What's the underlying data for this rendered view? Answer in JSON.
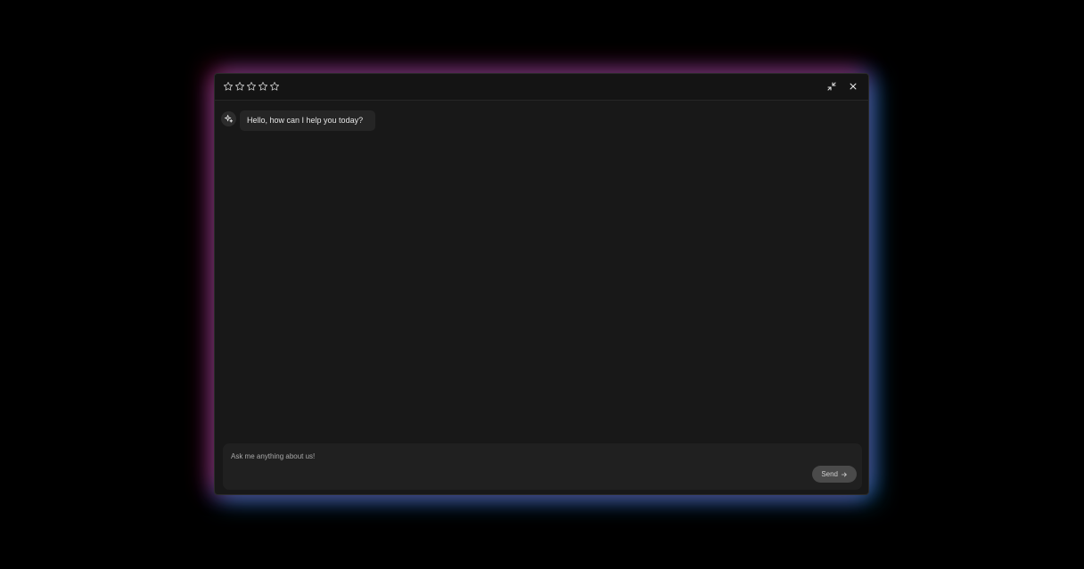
{
  "rating": {
    "stars_total": 5,
    "stars_filled": 0
  },
  "window": {
    "minimize_icon": "minimize-arrows-icon",
    "close_icon": "close-icon"
  },
  "messages": [
    {
      "role": "assistant",
      "avatar_icon": "sparkle-icon",
      "text": "Hello, how can I help you today?"
    }
  ],
  "composer": {
    "placeholder": "Ask me anything about us!",
    "value": "",
    "send_label": "Send",
    "send_icon": "arrow-right-icon"
  },
  "colors": {
    "background": "#000000",
    "panel": "#181818",
    "glow_left": "#c81446",
    "glow_right": "#14a0e6"
  }
}
